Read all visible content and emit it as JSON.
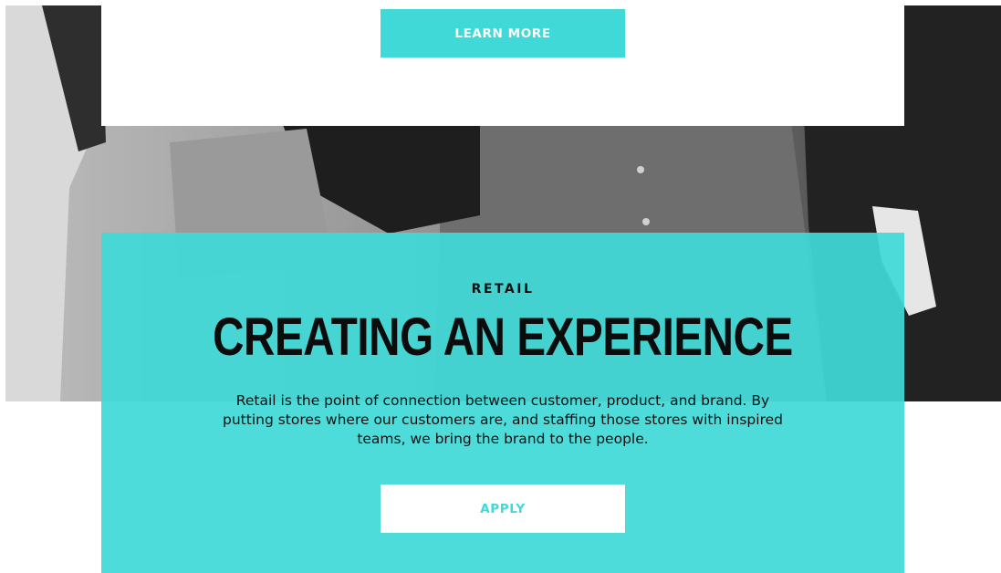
{
  "top_card": {
    "learn_more_label": "LEARN MORE"
  },
  "hero": {
    "eyebrow": "RETAIL",
    "headline": "CREATING AN EXPERIENCE",
    "body": "Retail is the point of connection between customer, product, and brand. By putting stores where our customers are, and staffing those stores with inspired teams, we bring the brand to the people.",
    "apply_label": "APPLY"
  },
  "colors": {
    "accent": "#40d9d7",
    "text_dark": "#111111",
    "card_white": "#ffffff"
  }
}
